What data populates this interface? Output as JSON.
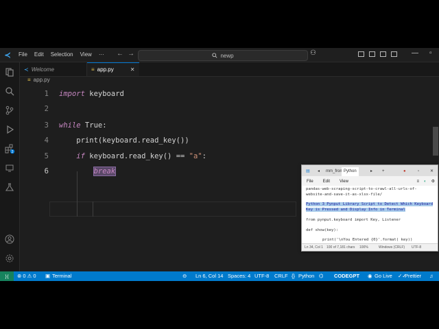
{
  "titlebar": {
    "menu": [
      "File",
      "Edit",
      "Selection",
      "View"
    ],
    "more_label": "···",
    "search_text": "newp"
  },
  "tabs": [
    {
      "label": "Welcome"
    },
    {
      "label": "app.py"
    }
  ],
  "breadcrumb": {
    "file": "app.py"
  },
  "editor": {
    "current_line": 6,
    "selected_text": "break"
  },
  "statusbar": {
    "problems": "⊗ 0 ⚠ 0",
    "terminal": "Terminal",
    "position": "Ln 6, Col 14",
    "spaces": "Spaces: 4",
    "encoding": "UTF-8",
    "eol": "CRLF",
    "language": "Python",
    "codegpt": "CODEGPT",
    "golive": "Go Live",
    "prettier": "Prettier",
    "color": "#007acc"
  },
  "notepad": {
    "tab_inactive": "mm_from",
    "tab_active": "Python",
    "menu": [
      "File",
      "Edit",
      "View"
    ],
    "lines": [
      "pandas-web-scraping-script-to-crawl-all-urls-of-",
      "website-and-save-it-as-xlsx-file/",
      "Python 3 Pynput Library Script to Detect Which Keyboard",
      "Key is Pressed and Display Info in Terminal",
      "from pynput.keyboard import Key, Listener",
      "def show(key):",
      "print('\\nYou Entered {0}'.format( key))"
    ],
    "status": {
      "position": "Ln 34, Col 1",
      "chars": "100 of 7,181 chars",
      "zoom": "100%",
      "eol": "Windows (CRLF)",
      "encoding": "UTF-8"
    }
  }
}
